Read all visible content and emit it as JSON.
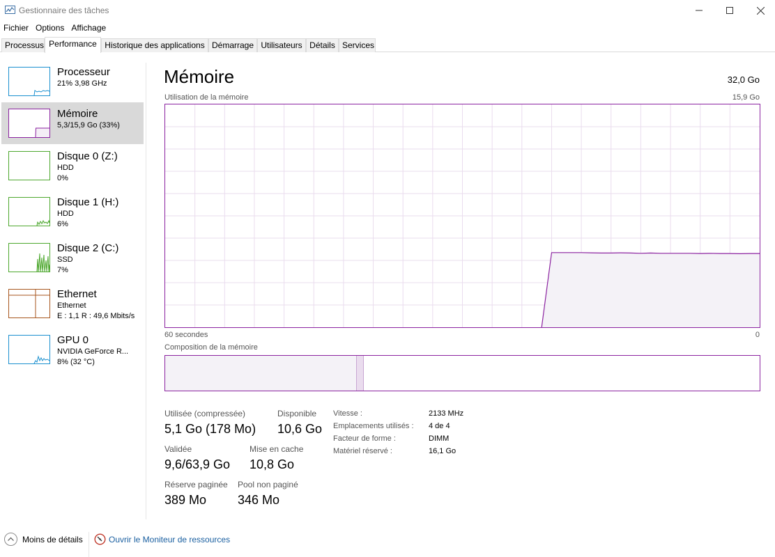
{
  "window": {
    "title": "Gestionnaire des tâches"
  },
  "menu": [
    "Fichier",
    "Options",
    "Affichage"
  ],
  "tabs": [
    "Processus",
    "Performance",
    "Historique des applications",
    "Démarrage",
    "Utilisateurs",
    "Détails",
    "Services"
  ],
  "sidebar": {
    "items": [
      {
        "name": "Processeur",
        "line1": "21%  3,98 GHz",
        "line2": "",
        "color": "#1a8fcf"
      },
      {
        "name": "Mémoire",
        "line1": "5,3/15,9 Go (33%)",
        "line2": "",
        "color": "#8b22a0"
      },
      {
        "name": "Disque 0 (Z:)",
        "line1": "HDD",
        "line2": "0%",
        "color": "#4ca72d"
      },
      {
        "name": "Disque 1 (H:)",
        "line1": "HDD",
        "line2": "6%",
        "color": "#4ca72d"
      },
      {
        "name": "Disque 2 (C:)",
        "line1": "SSD",
        "line2": "7%",
        "color": "#4ca72d"
      },
      {
        "name": "Ethernet",
        "line1": "Ethernet",
        "line2": "E : 1,1  R : 49,6 Mbits/s",
        "color": "#a7561d"
      },
      {
        "name": "GPU 0",
        "line1": "NVIDIA GeForce R...",
        "line2": "8% (32 °C)",
        "color": "#1a8fcf"
      }
    ]
  },
  "main": {
    "title": "Mémoire",
    "total": "32,0 Go",
    "graph_label": "Utilisation de la mémoire",
    "graph_max": "15,9 Go",
    "axis_left": "60 secondes",
    "axis_right": "0",
    "composition_label": "Composition de la mémoire",
    "stats": {
      "used_label": "Utilisée (compressée)",
      "used_value": "5,1 Go (178 Mo)",
      "available_label": "Disponible",
      "available_value": "10,6 Go",
      "committed_label": "Validée",
      "committed_value": "9,6/63,9 Go",
      "cached_label": "Mise en cache",
      "cached_value": "10,8 Go",
      "paged_label": "Réserve paginée",
      "paged_value": "389 Mo",
      "nonpaged_label": "Pool non paginé",
      "nonpaged_value": "346 Mo"
    },
    "details": [
      {
        "label": "Vitesse :",
        "value": "2133 MHz"
      },
      {
        "label": "Emplacements utilisés :",
        "value": "4 de 4"
      },
      {
        "label": "Facteur de forme :",
        "value": "DIMM"
      },
      {
        "label": "Matériel réservé :",
        "value": "16,1 Go"
      }
    ],
    "usage_history_percent": [
      0,
      0,
      0,
      0,
      0,
      0,
      0,
      0,
      0,
      0,
      0,
      0,
      0,
      0,
      0,
      0,
      0,
      0,
      0,
      0,
      0,
      0,
      0,
      0,
      0,
      0,
      0,
      0,
      0,
      0,
      0,
      0,
      0,
      0,
      0,
      0,
      0,
      0,
      0,
      33.5,
      33.5,
      33.5,
      33.5,
      33.4,
      33.3,
      33.3,
      33.4,
      33.3,
      33.2,
      33.3,
      33.2,
      33.2,
      33.2,
      33.2,
      33.1,
      33.2,
      33.1,
      33.1,
      33.0,
      33.1,
      33.1
    ],
    "composition_fractions": {
      "in_use": 0.322,
      "modified": 0.012
    }
  },
  "footer": {
    "less_details": "Moins de détails",
    "resource_monitor": "Ouvrir le Moniteur de ressources"
  },
  "colors": {
    "memory": "#8b22a0",
    "grid": "#eadcee",
    "link": "#1a5fa0"
  }
}
